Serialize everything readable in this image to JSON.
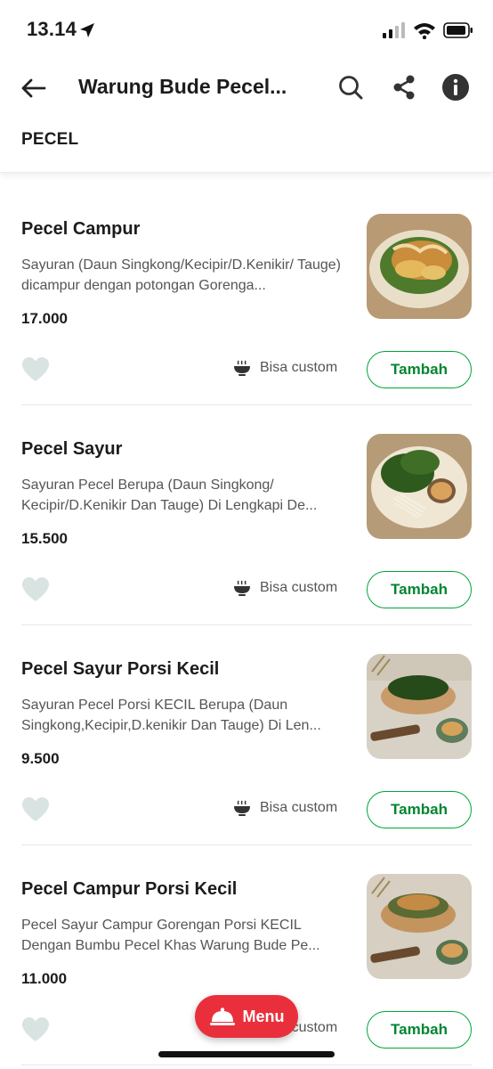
{
  "status_bar": {
    "time": "13.14"
  },
  "header": {
    "title": "Warung Bude Pecel...",
    "section": "PECEL"
  },
  "items": [
    {
      "name": "Pecel Campur",
      "description": "Sayuran (Daun Singkong/Kecipir/D.Kenikir/ Tauge) dicampur dengan potongan Gorenga...",
      "price": "17.000",
      "custom_label": "Bisa custom",
      "add_label": "Tambah"
    },
    {
      "name": "Pecel Sayur",
      "description": "Sayuran Pecel Berupa (Daun Singkong/ Kecipir/D.Kenikir Dan Tauge) Di Lengkapi De...",
      "price": "15.500",
      "custom_label": "Bisa custom",
      "add_label": "Tambah"
    },
    {
      "name": "Pecel Sayur Porsi Kecil",
      "description": "Sayuran Pecel Porsi KECIL Berupa (Daun Singkong,Kecipir,D.kenikir Dan Tauge) Di Len...",
      "price": "9.500",
      "custom_label": "Bisa custom",
      "add_label": "Tambah"
    },
    {
      "name": "Pecel Campur Porsi Kecil",
      "description": "Pecel Sayur Campur Gorengan Porsi KECIL Dengan Bumbu Pecel Khas Warung Bude Pe...",
      "price": "11.000",
      "custom_label": "Bisa custom",
      "add_label": "Tambah"
    }
  ],
  "menu_button": {
    "label": "Menu"
  },
  "colors": {
    "accent_green": "#00a63b",
    "menu_red": "#ea2f3c"
  }
}
